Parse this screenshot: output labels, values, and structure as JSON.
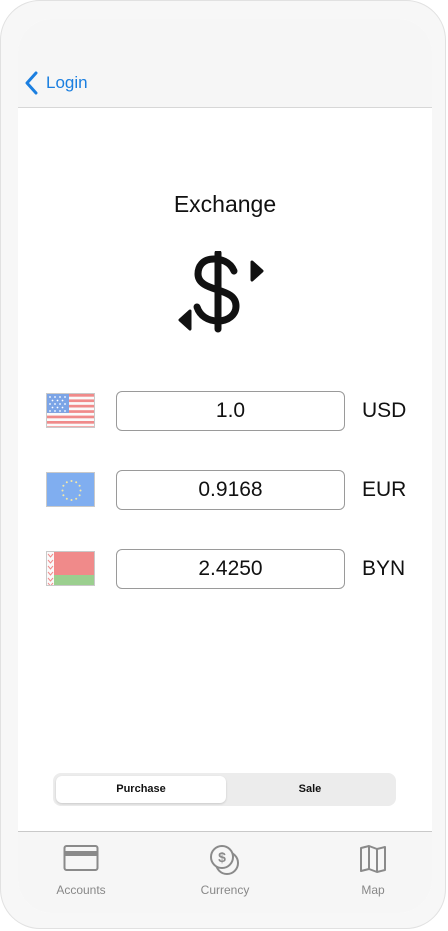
{
  "nav": {
    "back_label": "Login"
  },
  "screen": {
    "title": "Exchange"
  },
  "currencies": [
    {
      "code": "USD",
      "value": "1.0",
      "flag": "us-flag"
    },
    {
      "code": "EUR",
      "value": "0.9168",
      "flag": "eu-flag"
    },
    {
      "code": "BYN",
      "value": "2.4250",
      "flag": "by-flag"
    }
  ],
  "segment": {
    "options": [
      "Purchase",
      "Sale"
    ],
    "selected": "Purchase"
  },
  "tabbar": {
    "items": [
      {
        "label": "Accounts",
        "icon": "card-icon"
      },
      {
        "label": "Currency",
        "icon": "coins-icon"
      },
      {
        "label": "Map",
        "icon": "map-icon"
      }
    ]
  },
  "colors": {
    "accent": "#1b7fe0",
    "tab_inactive": "#888888",
    "nav_bg": "#f6f6f6"
  }
}
